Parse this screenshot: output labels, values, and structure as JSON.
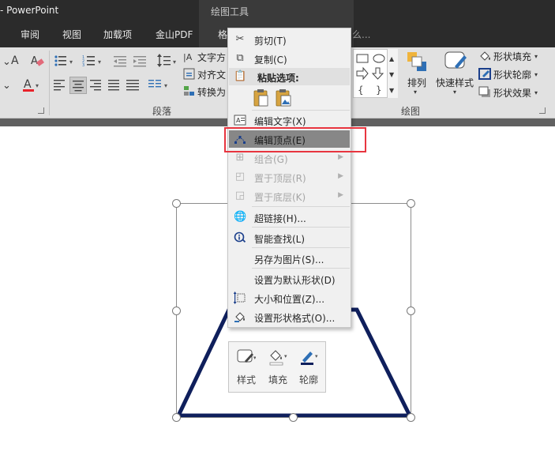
{
  "app": {
    "title": "- PowerPoint",
    "context_tab_title": "绘图工具"
  },
  "tabs": [
    {
      "label": "审阅"
    },
    {
      "label": "视图"
    },
    {
      "label": "加载项"
    },
    {
      "label": "金山PDF"
    },
    {
      "label": "格"
    }
  ],
  "tell_me": "么...",
  "ribbon": {
    "paragraph_group": {
      "label": "段落",
      "text_direction": "文字方",
      "align_text": "对齐文",
      "convert": "转换为"
    },
    "drawing_group": {
      "label": "绘图",
      "arrange": "排列",
      "quick_styles": "快速样式",
      "shape_fill": "形状填充",
      "shape_outline": "形状轮廓",
      "shape_effects": "形状效果"
    }
  },
  "context_menu": {
    "cut": "剪切(T)",
    "copy": "复制(C)",
    "paste_options": "粘贴选项:",
    "edit_text": "编辑文字(X)",
    "edit_points": "编辑顶点(E)",
    "group": "组合(G)",
    "bring_to_front": "置于顶层(R)",
    "send_to_back": "置于底层(K)",
    "hyperlink": "超链接(H)...",
    "smart_lookup": "智能查找(L)",
    "save_as_picture": "另存为图片(S)...",
    "set_default_shape": "设置为默认形状(D)",
    "size_and_position": "大小和位置(Z)...",
    "format_shape": "设置形状格式(O)..."
  },
  "mini_toolbar": {
    "style": "样式",
    "fill": "填充",
    "outline": "轮廓"
  },
  "colors": {
    "title_bar": "#2b2b2b",
    "ribbon": "#e1e1e1",
    "shape_outline": "#0f1f5c",
    "highlight": "#e8353f",
    "menu_hover": "#878787",
    "font_color_bar": "#e8222a"
  }
}
